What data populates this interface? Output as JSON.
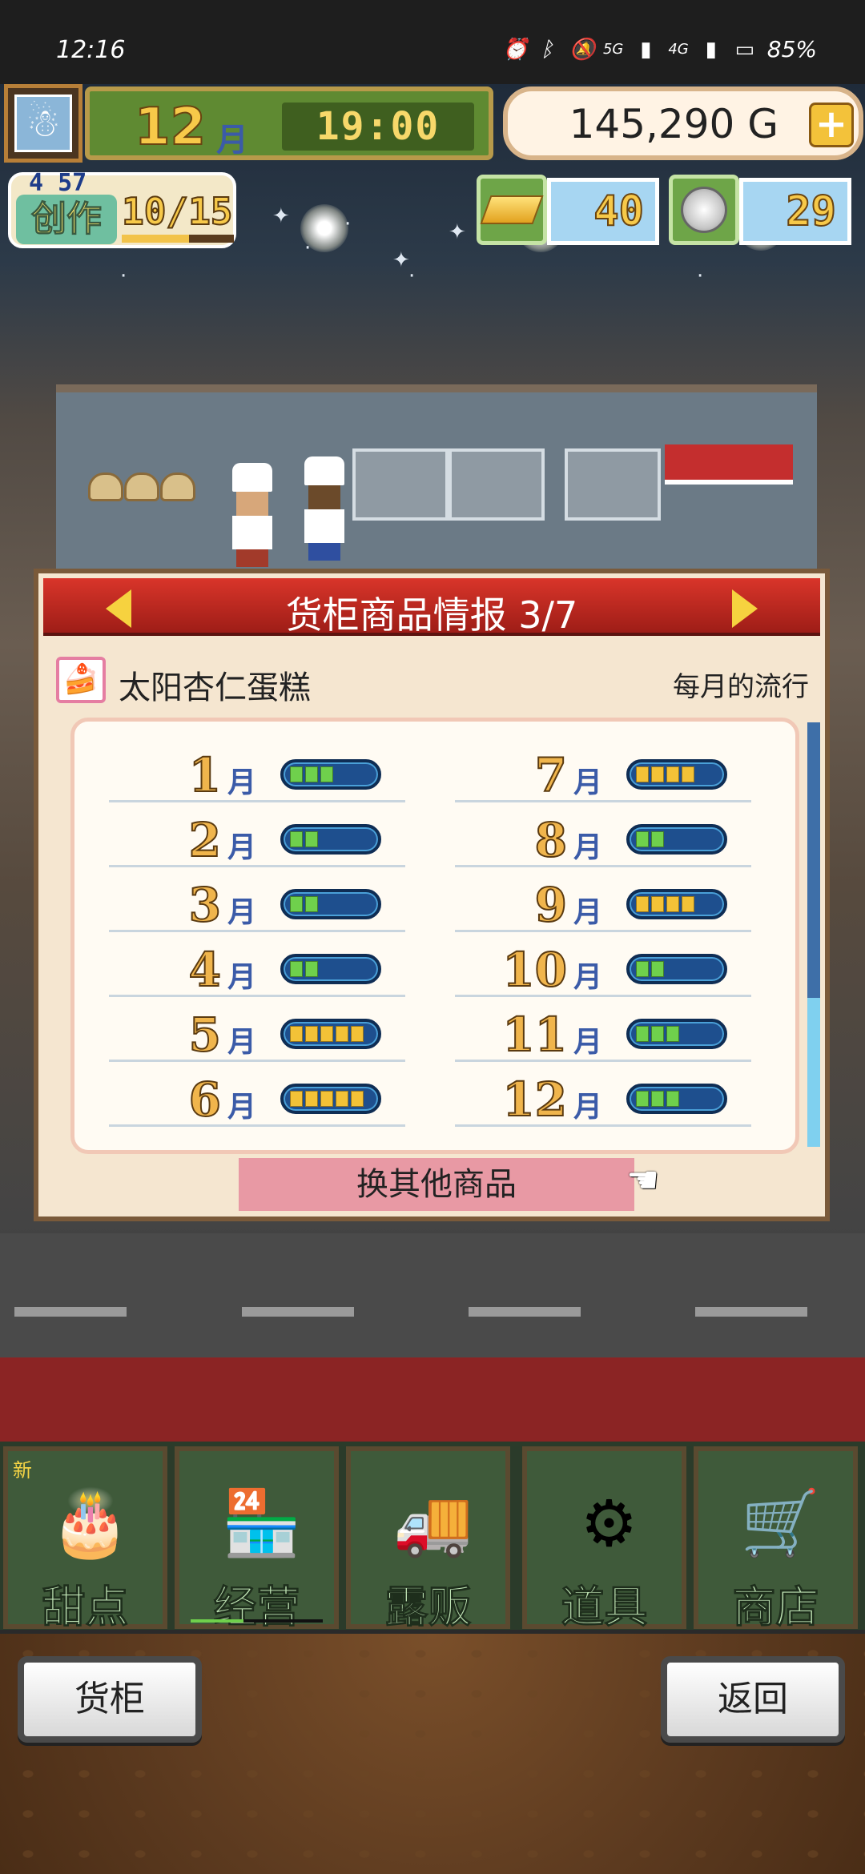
{
  "status_bar": {
    "time": "12:16",
    "battery": "85%",
    "signal_labels": [
      "5G",
      "4G"
    ]
  },
  "hud": {
    "month": "12",
    "month_unit": "月",
    "clock": "19:00",
    "gold": "145,290 G",
    "create": {
      "level": "4",
      "sub": "57",
      "label": "创作",
      "count": "10/15",
      "progress": 0.6
    },
    "gold_bars": "40",
    "silver_coins": "29"
  },
  "dialog": {
    "title": "货柜商品情报 3/7",
    "item_name": "太阳杏仁蛋糕",
    "trend_label": "每月的流行",
    "month_unit": "月",
    "months_left": [
      {
        "num": "1",
        "level": 3,
        "color": "green"
      },
      {
        "num": "2",
        "level": 2,
        "color": "green"
      },
      {
        "num": "3",
        "level": 2,
        "color": "green"
      },
      {
        "num": "4",
        "level": 2,
        "color": "green"
      },
      {
        "num": "5",
        "level": 5,
        "color": "gold"
      },
      {
        "num": "6",
        "level": 5,
        "color": "gold"
      }
    ],
    "months_right": [
      {
        "num": "7",
        "level": 4,
        "color": "gold"
      },
      {
        "num": "8",
        "level": 2,
        "color": "green"
      },
      {
        "num": "9",
        "level": 4,
        "color": "gold"
      },
      {
        "num": "10",
        "level": 2,
        "color": "green"
      },
      {
        "num": "11",
        "level": 3,
        "color": "green"
      },
      {
        "num": "12",
        "level": 3,
        "color": "green"
      }
    ],
    "switch_button": "换其他商品"
  },
  "nav": {
    "new_badge": "新",
    "items": [
      "甜点",
      "经营",
      "露贩",
      "道具",
      "商店"
    ]
  },
  "footer": {
    "left_button": "货柜",
    "right_button": "返回"
  },
  "colors": {
    "header_red": "#c22a22",
    "meter_green": "#6fd04c",
    "meter_gold": "#f3c237",
    "button_pink": "#e899a4"
  }
}
